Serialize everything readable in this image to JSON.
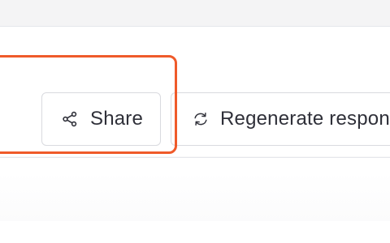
{
  "actions": {
    "share_label": "Share",
    "regenerate_label": "Regenerate response"
  },
  "icons": {
    "share": "share-icon",
    "regenerate": "refresh-icon"
  },
  "colors": {
    "highlight": "#ef5a2a",
    "button_border": "#d9dadf",
    "button_text": "#2f3039"
  }
}
